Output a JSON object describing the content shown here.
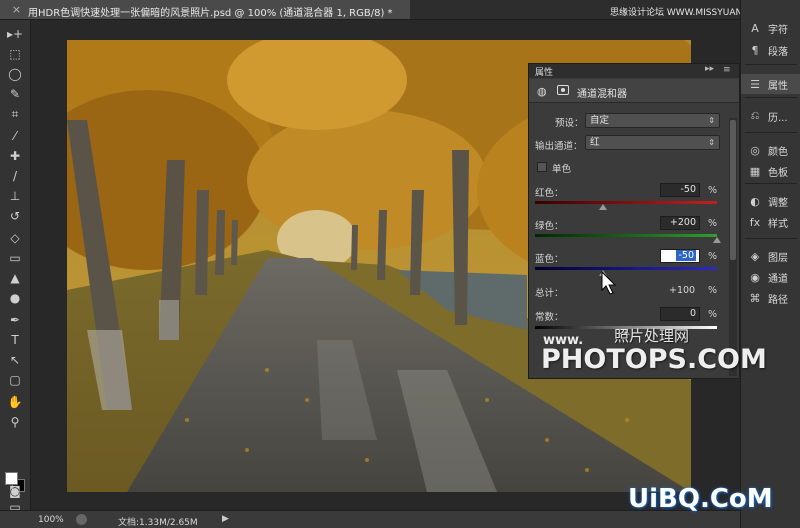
{
  "document": {
    "tab_title": "用HDR色调快速处理一张偏暗的风景照片.psd @ 100% (通道混合器 1, RGB/8) *",
    "close_glyph": "×"
  },
  "site_watermark_top": "思缘设计论坛 WWW.MISSYUAN.COM",
  "tools": [
    "move-tool-icon",
    "marquee-tool-icon",
    "lasso-tool-icon",
    "quick-select-icon",
    "crop-tool-icon",
    "eyedropper-icon",
    "healing-brush-icon",
    "brush-tool-icon",
    "clone-stamp-icon",
    "history-brush-icon",
    "eraser-icon",
    "gradient-tool-icon",
    "blur-tool-icon",
    "dodge-tool-icon",
    "pen-tool-icon",
    "type-tool-icon",
    "path-select-icon",
    "rectangle-tool-icon",
    "hand-tool-icon",
    "zoom-tool-icon"
  ],
  "tool_glyphs": [
    "▸+",
    "⬚",
    "◯",
    "✎",
    "⌗",
    "⁄",
    "✚",
    "/",
    "⊥",
    "↺",
    "◇",
    "▭",
    "▲",
    "●",
    "✒",
    "T",
    "↖",
    "▢",
    "✋",
    "⚲"
  ],
  "status": {
    "zoom": "100%",
    "doc_size": "文档:1.33M/2.65M",
    "arrow": "▶"
  },
  "dock": {
    "items": [
      {
        "icon": "A",
        "label": "字符"
      },
      {
        "icon": "¶",
        "label": "段落"
      },
      {
        "icon": "☰",
        "label": "属性"
      },
      {
        "icon": "⎌",
        "label": "历..."
      },
      {
        "icon": "◎",
        "label": "颜色"
      },
      {
        "icon": "▦",
        "label": "色板"
      },
      {
        "icon": "◐",
        "label": "调整"
      },
      {
        "icon": "fx",
        "label": "样式"
      },
      {
        "icon": "◈",
        "label": "图层"
      },
      {
        "icon": "◉",
        "label": "通道"
      },
      {
        "icon": "⌘",
        "label": "路径"
      }
    ]
  },
  "properties": {
    "title": "属性",
    "expand_glyph": "▸▸",
    "menu_glyph": "≡",
    "adjustment_name": "通道混和器",
    "preset_label": "预设：",
    "preset_value": "自定",
    "output_label": "输出通道：",
    "output_value": "红",
    "mono_label": "单色",
    "red_label": "红色：",
    "red_value": "-50",
    "green_label": "绿色：",
    "green_value": "+200",
    "blue_label": "蓝色：",
    "blue_value": "-50",
    "total_label": "总计：",
    "total_value": "+100",
    "constant_label": "常数：",
    "constant_value": "0",
    "percent": "%",
    "red_slider": -50,
    "green_slider": 200,
    "blue_slider": -50,
    "constant_slider": 0
  },
  "watermarks": {
    "cn": "照片处理网",
    "www": "www.",
    "photops": "PHOTOPS.COM",
    "uibq": "UiBQ.CoM"
  },
  "colors": {
    "panel_bg": "#3b3b3b",
    "red_track": "#c22020",
    "green_track": "#2f9e2f",
    "blue_track": "#2b2bc8",
    "selection": "#2e66c8"
  }
}
